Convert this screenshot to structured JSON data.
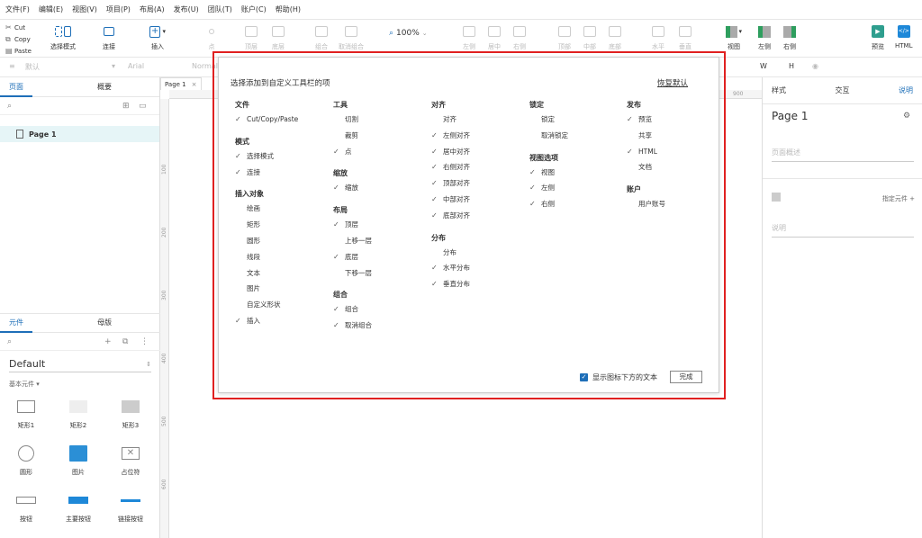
{
  "menu": [
    "文件(F)",
    "编辑(E)",
    "视图(V)",
    "项目(P)",
    "布局(A)",
    "发布(U)",
    "团队(T)",
    "账户(C)",
    "帮助(H)"
  ],
  "clipboard": {
    "cut": "Cut",
    "copy": "Copy",
    "paste": "Paste"
  },
  "toolbar": {
    "select_mode": "选择模式",
    "connect": "连接",
    "insert": "插入",
    "point": "点",
    "top_layer": "顶层",
    "bottom_layer": "底层",
    "group": "组合",
    "ungroup": "取消组合",
    "zoom": "100%",
    "align_left": "左侧",
    "align_center": "居中",
    "align_right": "右侧",
    "align_top": "顶部",
    "align_middle": "中部",
    "align_bottom": "底部",
    "horizontal": "水平",
    "vertical": "垂直",
    "view": "视图",
    "left": "左侧",
    "right": "右侧",
    "preview": "预览",
    "html": "HTML"
  },
  "format": {
    "style": "默认",
    "font": "Arial",
    "weight": "Normal",
    "w": "W",
    "h": "H"
  },
  "left_panel": {
    "tabs": [
      "页面",
      "概要"
    ],
    "page": "Page 1",
    "lib_tabs": [
      "元件",
      "母版"
    ],
    "library": "Default",
    "section": "基本元件 ▾",
    "widgets": [
      "矩形1",
      "矩形2",
      "矩形3",
      "圆形",
      "图片",
      "占位符",
      "按钮",
      "主要按钮",
      "链接按钮"
    ]
  },
  "canvas": {
    "page_tab": "Page 1",
    "ruler_v": [
      "100",
      "200",
      "300",
      "400",
      "500",
      "600"
    ],
    "ruler_h": "900"
  },
  "right_panel": {
    "tabs": [
      "样式",
      "交互",
      "说明"
    ],
    "page_name": "Page 1",
    "page_desc_placeholder": "页面概述",
    "assign": "指定元件 +",
    "note_placeholder": "说明"
  },
  "dialog": {
    "title": "选择添加到自定义工具栏的项",
    "reset": "恢复默认",
    "show_text_label": "显示图标下方的文本",
    "done": "完成",
    "columns": [
      [
        {
          "header": "文件",
          "items": [
            {
              "label": "Cut/Copy/Paste",
              "checked": true
            }
          ]
        },
        {
          "header": "模式",
          "items": [
            {
              "label": "选择模式",
              "checked": true
            },
            {
              "label": "连接",
              "checked": true
            }
          ]
        },
        {
          "header": "插入对象",
          "items": [
            {
              "label": "绘画",
              "checked": false
            },
            {
              "label": "矩形",
              "checked": false
            },
            {
              "label": "圆形",
              "checked": false
            },
            {
              "label": "线段",
              "checked": false
            },
            {
              "label": "文本",
              "checked": false
            },
            {
              "label": "图片",
              "checked": false
            },
            {
              "label": "自定义形状",
              "checked": false
            },
            {
              "label": "插入",
              "checked": true
            }
          ]
        }
      ],
      [
        {
          "header": "工具",
          "items": [
            {
              "label": "切割",
              "checked": false
            },
            {
              "label": "裁剪",
              "checked": false
            },
            {
              "label": "点",
              "checked": true
            }
          ]
        },
        {
          "header": "缩放",
          "items": [
            {
              "label": "缩放",
              "checked": true
            }
          ]
        },
        {
          "header": "布局",
          "items": [
            {
              "label": "顶层",
              "checked": true
            },
            {
              "label": "上移一层",
              "checked": false
            },
            {
              "label": "底层",
              "checked": true
            },
            {
              "label": "下移一层",
              "checked": false
            }
          ]
        },
        {
          "header": "组合",
          "items": [
            {
              "label": "组合",
              "checked": true
            },
            {
              "label": "取消组合",
              "checked": true
            }
          ]
        }
      ],
      [
        {
          "header": "对齐",
          "items": [
            {
              "label": "对齐",
              "checked": false
            },
            {
              "label": "左侧对齐",
              "checked": true
            },
            {
              "label": "居中对齐",
              "checked": true
            },
            {
              "label": "右侧对齐",
              "checked": true
            },
            {
              "label": "顶部对齐",
              "checked": true
            },
            {
              "label": "中部对齐",
              "checked": true
            },
            {
              "label": "底部对齐",
              "checked": true
            }
          ]
        },
        {
          "header": "分布",
          "items": [
            {
              "label": "分布",
              "checked": false
            },
            {
              "label": "水平分布",
              "checked": true
            },
            {
              "label": "垂直分布",
              "checked": true
            }
          ]
        }
      ],
      [
        {
          "header": "锁定",
          "items": [
            {
              "label": "锁定",
              "checked": false
            },
            {
              "label": "取消锁定",
              "checked": false
            }
          ]
        },
        {
          "header": "视图选项",
          "items": [
            {
              "label": "视图",
              "checked": true
            },
            {
              "label": "左侧",
              "checked": true
            },
            {
              "label": "右侧",
              "checked": true
            }
          ]
        }
      ],
      [
        {
          "header": "发布",
          "items": [
            {
              "label": "预览",
              "checked": true
            },
            {
              "label": "共享",
              "checked": false
            },
            {
              "label": "HTML",
              "checked": true
            },
            {
              "label": "文档",
              "checked": false
            }
          ]
        },
        {
          "header": "账户",
          "items": [
            {
              "label": "用户账号",
              "checked": false
            }
          ]
        }
      ]
    ]
  }
}
